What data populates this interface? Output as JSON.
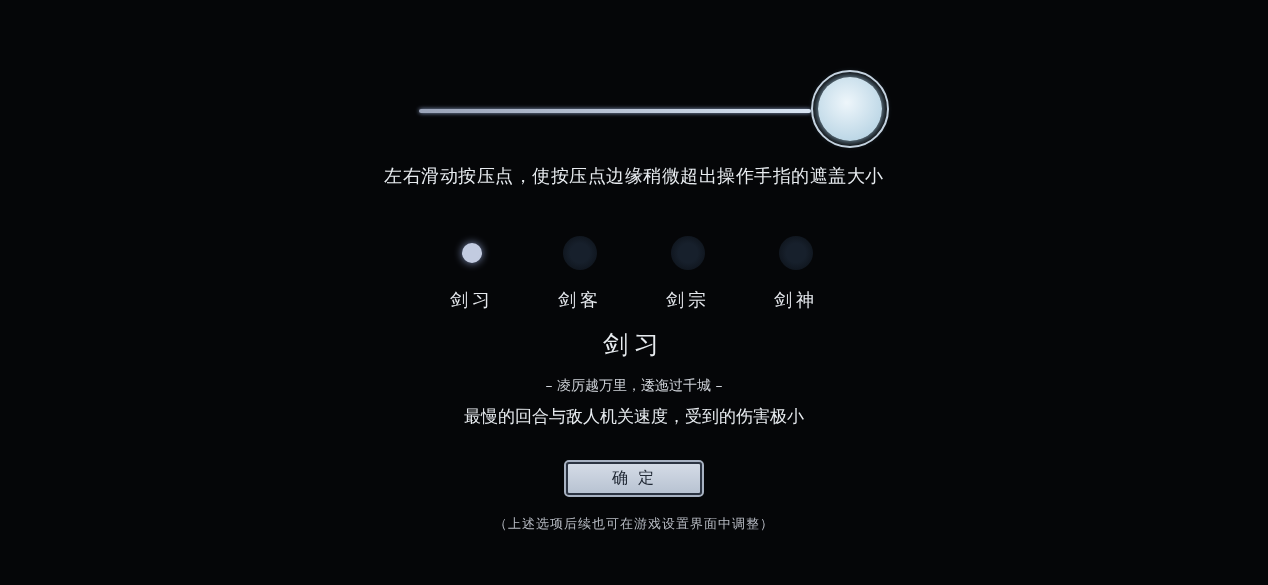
{
  "slider": {
    "level": 1
  },
  "hint": "左右滑动按压点，使按压点边缘稍微超出操作手指的遮盖大小",
  "difficulties": [
    {
      "label": "剑习",
      "selected": true
    },
    {
      "label": "剑客",
      "selected": false
    },
    {
      "label": "剑宗",
      "selected": false
    },
    {
      "label": "剑神",
      "selected": false
    }
  ],
  "detail": {
    "title": "剑习",
    "motto": "– 凌厉越万里，逶迤过千城 –",
    "description": "最慢的回合与敌人机关速度，受到的伤害极小"
  },
  "confirm_button": "确 定",
  "footnote": "（上述选项后续也可在游戏设置界面中调整）"
}
